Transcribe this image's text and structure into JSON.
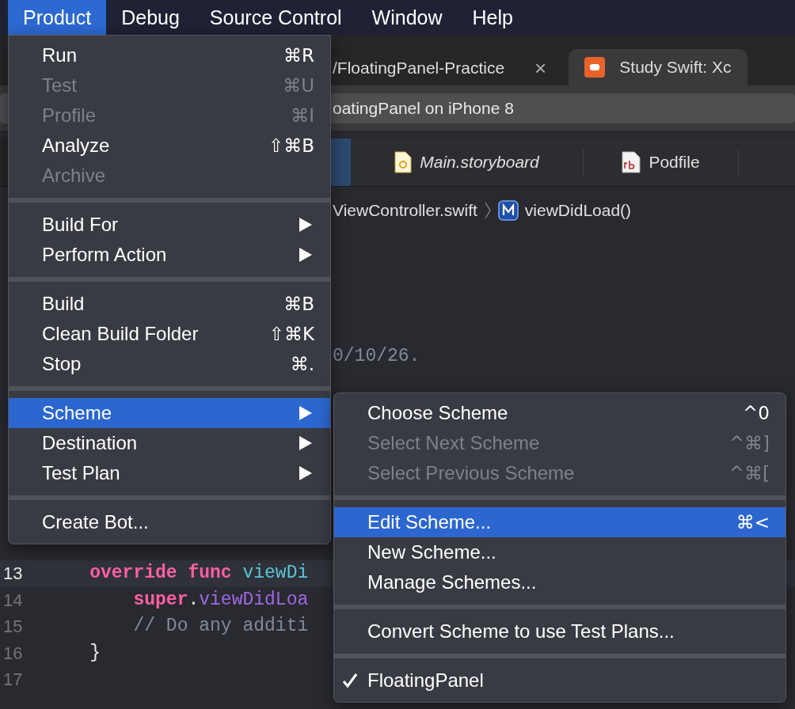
{
  "menu_bar": [
    {
      "label": "Product",
      "selected": true
    },
    {
      "label": "Debug",
      "selected": false
    },
    {
      "label": "Source Control",
      "selected": false
    },
    {
      "label": "Window",
      "selected": false
    },
    {
      "label": "Help",
      "selected": false
    }
  ],
  "browser_tabs": [
    {
      "label": "/FloatingPanel-Practice",
      "close": "×",
      "selected": false
    },
    {
      "label": "Study Swift: Xc",
      "selected": true
    }
  ],
  "toolbar": {
    "scheme_status": "oatingPanel on iPhone 8"
  },
  "editor_tabs": [
    {
      "selected": true,
      "kind": "blank"
    },
    {
      "label": "Main.storyboard",
      "selected": false,
      "kind": "storyboard"
    },
    {
      "label": "Podfile",
      "selected": false,
      "kind": "ruby"
    }
  ],
  "jump_bar": {
    "file": "ViewController.swift",
    "method": "viewDidLoad()"
  },
  "code": {
    "header_fragment": "0/10/26.",
    "lines": [
      {
        "number": "13",
        "current": true,
        "tokens": [
          {
            "text": "    override",
            "kind": "keyword"
          },
          {
            "text": " func",
            "kind": "keyword"
          },
          {
            "text": " viewDi",
            "kind": "declaration"
          }
        ]
      },
      {
        "number": "14",
        "current": false,
        "tokens": [
          {
            "text": "        super",
            "kind": "keyword"
          },
          {
            "text": ".",
            "kind": "plain"
          },
          {
            "text": "viewDidLoa",
            "kind": "method"
          }
        ]
      },
      {
        "number": "15",
        "current": false,
        "tokens": [
          {
            "text": "        // Do any additi",
            "kind": "comment"
          }
        ]
      },
      {
        "number": "16",
        "current": false,
        "tokens": [
          {
            "text": "    }",
            "kind": "plain"
          }
        ]
      },
      {
        "number": "17",
        "current": false
      }
    ]
  },
  "product_menu": {
    "groups": [
      [
        {
          "label": "Run",
          "shortcut": "⌘R",
          "disabled": false,
          "submenu": false,
          "selected": false
        },
        {
          "label": "Test",
          "shortcut": "⌘U",
          "disabled": true,
          "submenu": false,
          "selected": false
        },
        {
          "label": "Profile",
          "shortcut": "⌘I",
          "disabled": true,
          "submenu": false,
          "selected": false
        },
        {
          "label": "Analyze",
          "shortcut": "⇧⌘B",
          "disabled": false,
          "submenu": false,
          "selected": false
        },
        {
          "label": "Archive",
          "disabled": true,
          "submenu": false,
          "selected": false
        }
      ],
      [
        {
          "label": "Build For",
          "disabled": false,
          "submenu": true,
          "selected": false
        },
        {
          "label": "Perform Action",
          "disabled": false,
          "submenu": true,
          "selected": false
        }
      ],
      [
        {
          "label": "Build",
          "shortcut": "⌘B",
          "disabled": false,
          "submenu": false,
          "selected": false
        },
        {
          "label": "Clean Build Folder",
          "shortcut": "⇧⌘K",
          "disabled": false,
          "submenu": false,
          "selected": false
        },
        {
          "label": "Stop",
          "shortcut": "⌘.",
          "disabled": false,
          "submenu": false,
          "selected": false
        }
      ],
      [
        {
          "label": "Scheme",
          "disabled": false,
          "submenu": true,
          "selected": true
        },
        {
          "label": "Destination",
          "disabled": false,
          "submenu": true,
          "selected": false
        },
        {
          "label": "Test Plan",
          "disabled": false,
          "submenu": true,
          "selected": false
        }
      ],
      [
        {
          "label": "Create Bot...",
          "disabled": false,
          "submenu": false,
          "selected": false
        }
      ]
    ]
  },
  "scheme_submenu": {
    "groups": [
      [
        {
          "label": "Choose Scheme",
          "shortcut": "^0",
          "disabled": false,
          "selected": false,
          "checked": false
        },
        {
          "label": "Select Next Scheme",
          "shortcut": "^⌘]",
          "disabled": true,
          "selected": false,
          "checked": false
        },
        {
          "label": "Select Previous Scheme",
          "shortcut": "^⌘[",
          "disabled": true,
          "selected": false,
          "checked": false
        }
      ],
      [
        {
          "label": "Edit Scheme...",
          "shortcut": "⌘<",
          "disabled": false,
          "selected": true,
          "checked": false
        },
        {
          "label": "New Scheme...",
          "disabled": false,
          "selected": false,
          "checked": false
        },
        {
          "label": "Manage Schemes...",
          "disabled": false,
          "selected": false,
          "checked": false
        }
      ],
      [
        {
          "label": "Convert Scheme to use Test Plans...",
          "disabled": false,
          "selected": false,
          "checked": false
        }
      ],
      [
        {
          "label": "FloatingPanel",
          "disabled": false,
          "selected": false,
          "checked": true
        }
      ]
    ]
  }
}
